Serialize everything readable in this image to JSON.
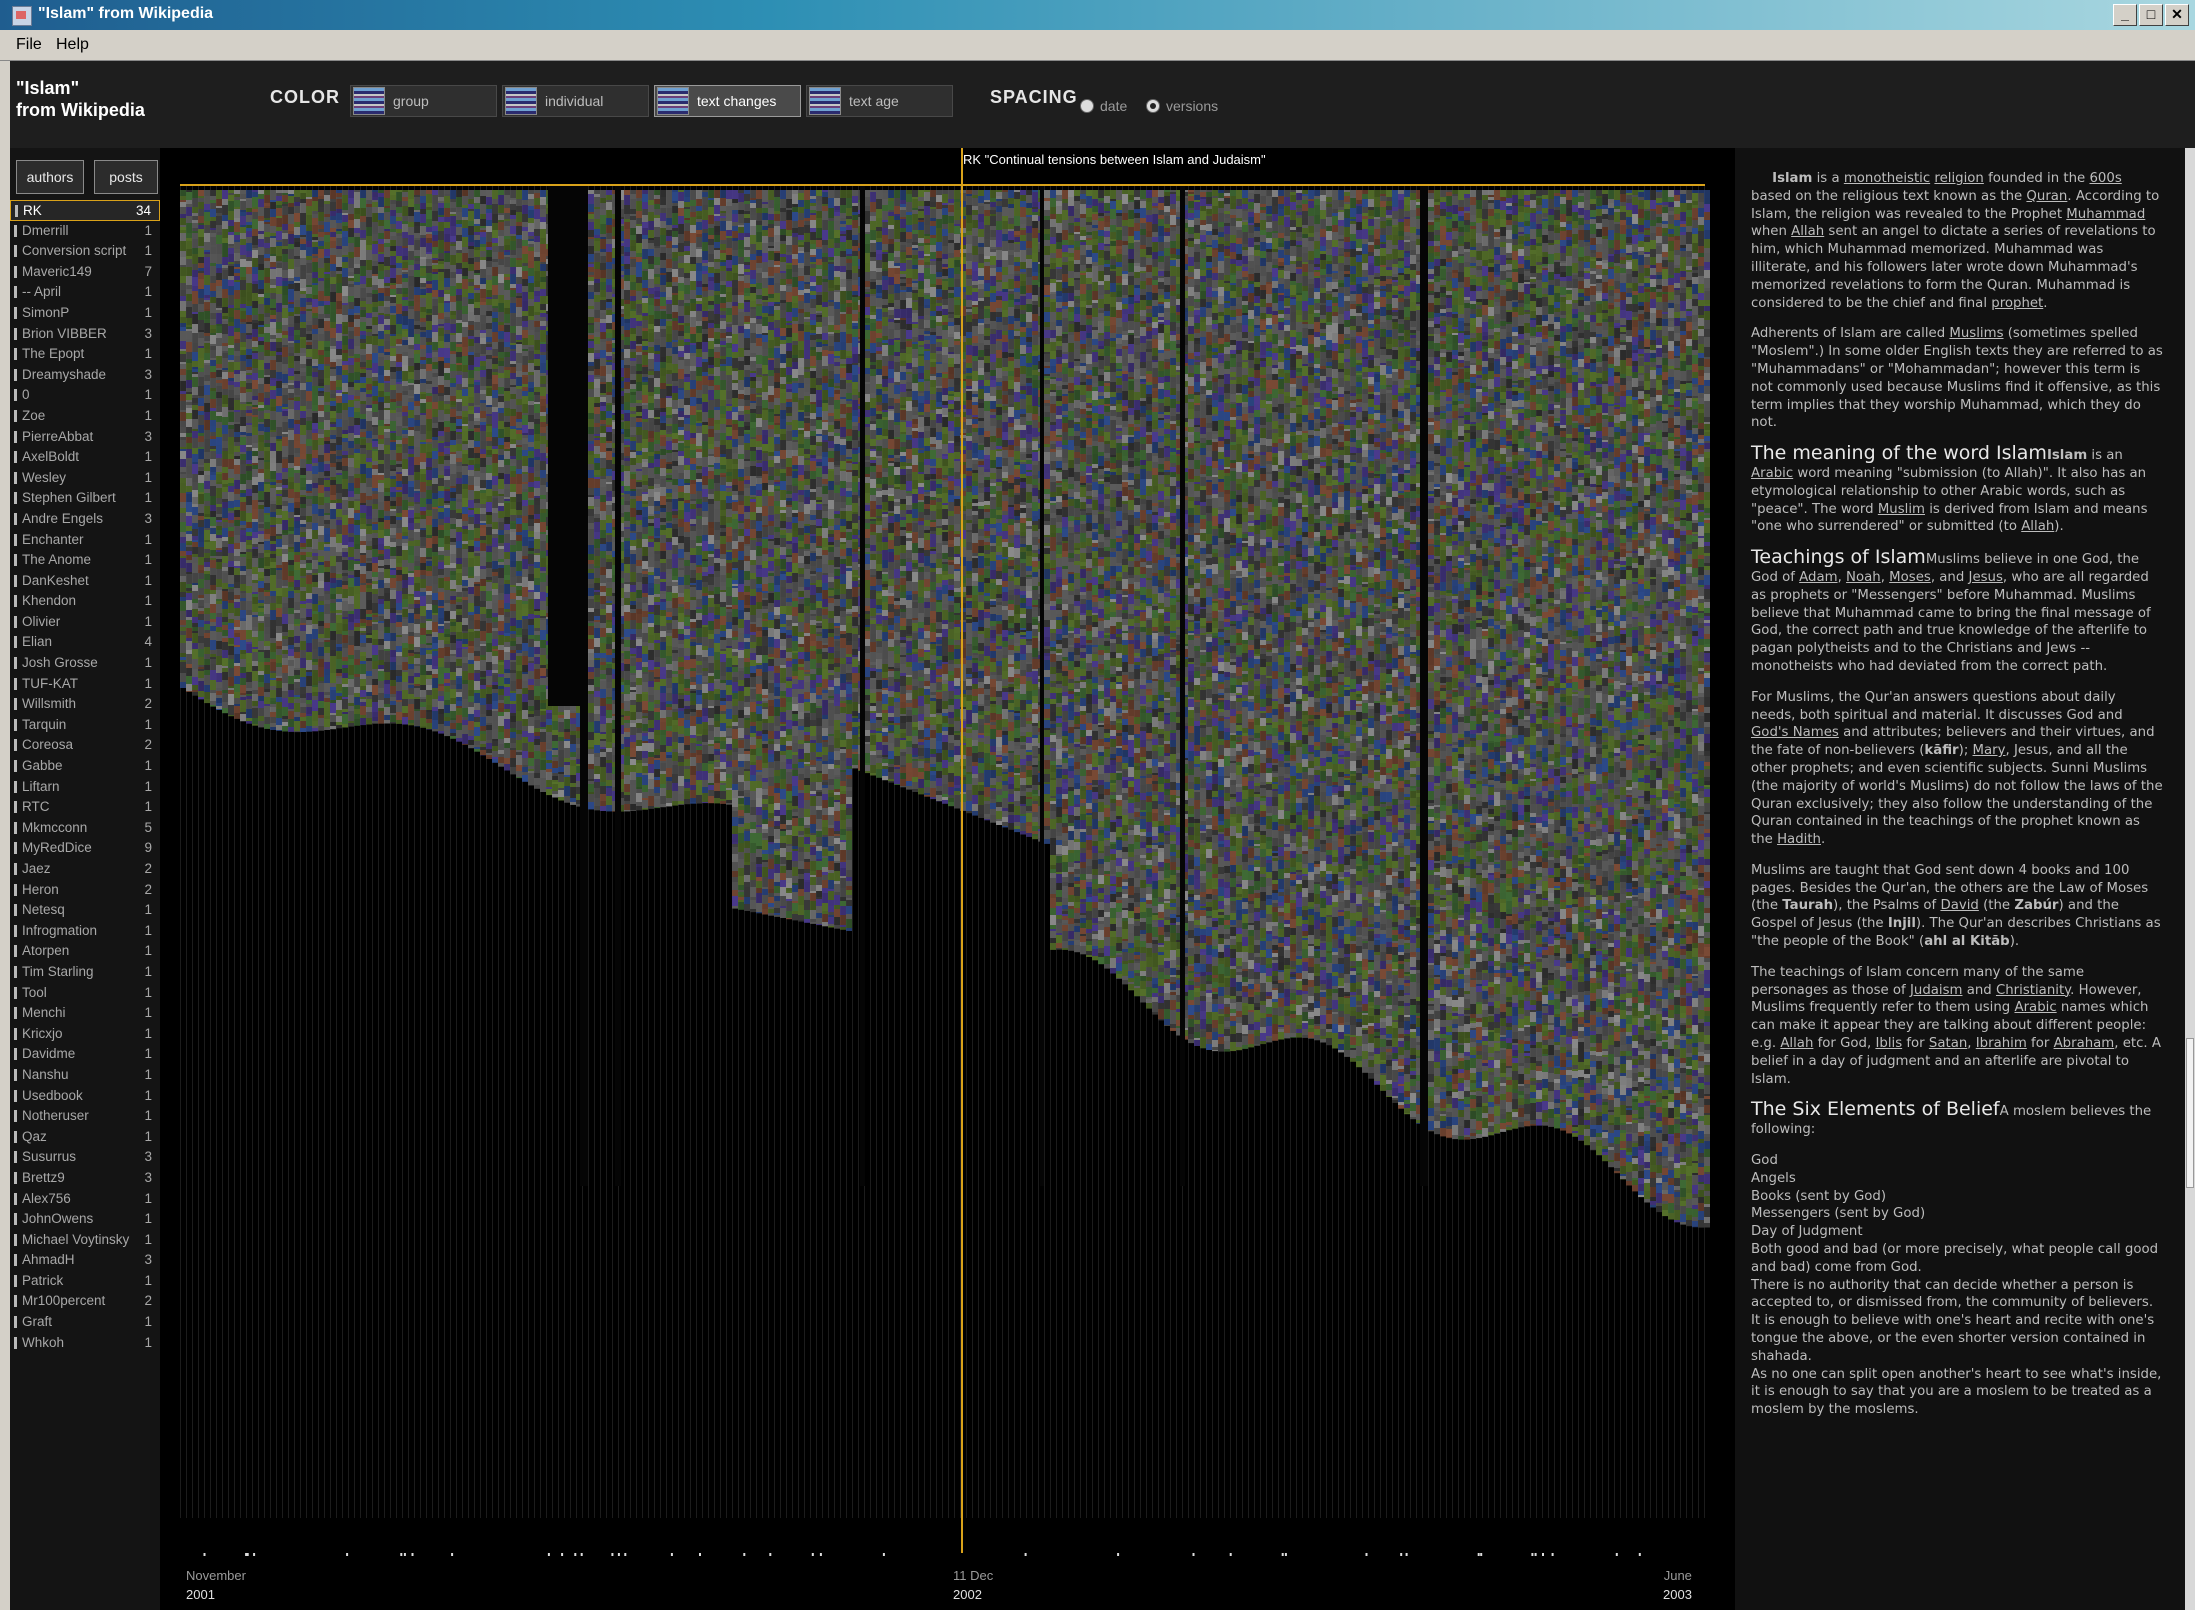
{
  "window": {
    "title": "\"Islam\" from Wikipedia",
    "minimize": "_",
    "maximize": "□",
    "close": "✕"
  },
  "menu": [
    {
      "label": "File"
    },
    {
      "label": "Help"
    }
  ],
  "app": {
    "title_line1": "\"Islam\"",
    "title_line2": "from Wikipedia"
  },
  "toolbar": {
    "color_label": "COLOR",
    "color_modes": [
      {
        "label": "group",
        "active": false
      },
      {
        "label": "individual",
        "active": false
      },
      {
        "label": "text changes",
        "active": true
      },
      {
        "label": "text age",
        "active": false
      }
    ],
    "spacing_label": "SPACING",
    "spacing_options": [
      {
        "label": "date",
        "selected": false
      },
      {
        "label": "versions",
        "selected": true
      }
    ]
  },
  "sidebar": {
    "tabs": [
      {
        "label": "authors"
      },
      {
        "label": "posts"
      }
    ],
    "authors": [
      {
        "name": "RK",
        "count": "34",
        "selected": true
      },
      {
        "name": "Dmerrill",
        "count": "1"
      },
      {
        "name": "Conversion script",
        "count": "1"
      },
      {
        "name": "Maveric149",
        "count": "7"
      },
      {
        "name": "-- April",
        "count": "1"
      },
      {
        "name": "SimonP",
        "count": "1"
      },
      {
        "name": "Brion VIBBER",
        "count": "3"
      },
      {
        "name": "The Epopt",
        "count": "1"
      },
      {
        "name": "Dreamyshade",
        "count": "3"
      },
      {
        "name": "0",
        "count": "1"
      },
      {
        "name": "Zoe",
        "count": "1"
      },
      {
        "name": "PierreAbbat",
        "count": "3"
      },
      {
        "name": "AxelBoldt",
        "count": "1"
      },
      {
        "name": "Wesley",
        "count": "1"
      },
      {
        "name": "Stephen Gilbert",
        "count": "1"
      },
      {
        "name": "Andre Engels",
        "count": "3"
      },
      {
        "name": "Enchanter",
        "count": "1"
      },
      {
        "name": "The Anome",
        "count": "1"
      },
      {
        "name": "DanKeshet",
        "count": "1"
      },
      {
        "name": "Khendon",
        "count": "1"
      },
      {
        "name": "Olivier",
        "count": "1"
      },
      {
        "name": "Elian",
        "count": "4"
      },
      {
        "name": "Josh Grosse",
        "count": "1"
      },
      {
        "name": "TUF-KAT",
        "count": "1"
      },
      {
        "name": "Willsmith",
        "count": "2"
      },
      {
        "name": "Tarquin",
        "count": "1"
      },
      {
        "name": "Coreosa",
        "count": "2"
      },
      {
        "name": "Gabbe",
        "count": "1"
      },
      {
        "name": "Liftarn",
        "count": "1"
      },
      {
        "name": "RTC",
        "count": "1"
      },
      {
        "name": "Mkmcconn",
        "count": "5"
      },
      {
        "name": "MyRedDice",
        "count": "9"
      },
      {
        "name": "Jaez",
        "count": "2"
      },
      {
        "name": "Heron",
        "count": "2"
      },
      {
        "name": "Netesq",
        "count": "1"
      },
      {
        "name": "Infrogmation",
        "count": "1"
      },
      {
        "name": "Atorpen",
        "count": "1"
      },
      {
        "name": "Tim Starling",
        "count": "1"
      },
      {
        "name": "Tool",
        "count": "1"
      },
      {
        "name": "Menchi",
        "count": "1"
      },
      {
        "name": "Kricxjo",
        "count": "1"
      },
      {
        "name": "Davidme",
        "count": "1"
      },
      {
        "name": "Nanshu",
        "count": "1"
      },
      {
        "name": "Usedbook",
        "count": "1"
      },
      {
        "name": "Notheruser",
        "count": "1"
      },
      {
        "name": "Qaz",
        "count": "1"
      },
      {
        "name": "Susurrus",
        "count": "3"
      },
      {
        "name": "Brettz9",
        "count": "3"
      },
      {
        "name": "Alex756",
        "count": "1"
      },
      {
        "name": "JohnOwens",
        "count": "1"
      },
      {
        "name": "Michael Voytinsky",
        "count": "1"
      },
      {
        "name": "AhmadH",
        "count": "3"
      },
      {
        "name": "Patrick",
        "count": "1"
      },
      {
        "name": "Mr100percent",
        "count": "2"
      },
      {
        "name": "Graft",
        "count": "1"
      },
      {
        "name": "Whkoh",
        "count": "1"
      }
    ]
  },
  "visualization": {
    "hover_label": "RK \"Continual tensions between Islam and Judaism\"",
    "dates": {
      "start": {
        "month": "November",
        "year": "2001"
      },
      "middle": {
        "month": "11 Dec",
        "year": "2002"
      },
      "end": {
        "month": "June",
        "year": "2003"
      }
    },
    "palette": {
      "gray": "#5c5c5c",
      "dark_gray": "#3a3a3a",
      "light_gray": "#8a8a8a",
      "olive": "#55702a",
      "green": "#3f6a35",
      "purple": "#4a3a8c",
      "blue": "#2d4a8a",
      "brown": "#7a4a35",
      "highlight": "#d9a21a"
    }
  },
  "article": {
    "p1": {
      "title": "Islam",
      "t1": " is a ",
      "l1": "monotheistic",
      "t2": " ",
      "l2": "religion",
      "t3": " founded in the ",
      "l3": "600s",
      "t4": " based on the religious text known as the ",
      "l4": "Quran",
      "t5": ". According to Islam, the religion was revealed to the Prophet ",
      "l5": "Muhammad",
      "t6": " when ",
      "l6": "Allah",
      "t7": " sent an angel to dictate a series of revelations to him, which Muhammad memorized.  Muhammad was illiterate, and his followers later wrote down Muhammad's memorized revelations to form the Quran. Muhammad is considered to be the chief and final ",
      "l7": "prophet",
      "t8": "."
    },
    "p2": {
      "t1": "Adherents of Islam are called ",
      "l1": "Muslims",
      "t2": " (sometimes spelled \"Moslem\".)  In some older English texts they are referred to as \"Muhammadans\" or \"Mohammadan\"; however this term is not commonly used because Muslims find it offensive, as this term implies that they worship Muhammad, which they do not."
    },
    "h1": "The meaning of the word Islam",
    "p3": {
      "lead": "Islam",
      "t1": " is an ",
      "l1": "Arabic",
      "t2": " word meaning \"submission (to Allah)\". It also has an etymological relationship to other Arabic words, such as \"peace\". The word ",
      "l2": "Muslim",
      "t3": " is derived from Islam and means \"one who surrendered\" or submitted (to ",
      "l3": "Allah",
      "t4": ")."
    },
    "h2": "Teachings of Islam",
    "p4": {
      "lead": "Muslims believe in one God, the God of ",
      "l1": "Adam",
      "t1": ", ",
      "l2": "Noah",
      "t2": ", ",
      "l3": "Moses",
      "t3": ", and ",
      "l4": "Jesus",
      "t4": ", who are all regarded as prophets or \"Messengers\" before Muhammad. Muslims believe that Muhammad came to bring the final message of God, the correct path and true knowledge of the afterlife to pagan polytheists and to the Christians and Jews -- monotheists who had deviated from the correct path."
    },
    "p5": {
      "t1": "For Muslims, the Qur'an answers questions about daily needs, both spiritual and material. It discusses God and ",
      "l1": "God's Names",
      "t2": " and attributes; believers and their virtues, and the fate of non-believers (",
      "b1": "kāfir",
      "t3": "); ",
      "l2": "Mary",
      "t4": ", Jesus, and all the other prophets; and even scientific subjects. Sunni Muslims (the majority of world's Muslims) do not follow the laws of the Quran exclusively; they also follow the understanding of the Quran contained in the teachings of the prophet known as the ",
      "l3": "Hadith",
      "t5": "."
    },
    "p6": {
      "t1": "Muslims are taught that God sent down 4 books and 100 pages. Besides the Qur'an, the others are the Law of Moses (the ",
      "b1": "Taurah",
      "t2": "), the Psalms of ",
      "l1": "David",
      "t3": " (the ",
      "b2": "Zabúr",
      "t4": ") and the Gospel of Jesus (the ",
      "b3": "Injil",
      "t5": "). The Qur'an describes Christians as \"the people of the Book\" (",
      "b4": "ahl al Kitāb",
      "t6": ")."
    },
    "p7": {
      "t1": "The teachings of Islam concern many of the same personages as those of ",
      "l1": "Judaism",
      "t2": " and ",
      "l2": "Christianity",
      "t3": ". However, Muslims frequently refer to them using ",
      "l3": "Arabic",
      "t4": " names which can make it appear they are talking about different people: e.g. ",
      "l4": "Allah",
      "t5": " for God, ",
      "l5": "Iblis",
      "t6": " for ",
      "l6": "Satan",
      "t7": ", ",
      "l7": "Ibrahim",
      "t8": " for ",
      "l8": "Abraham",
      "t9": ", etc.  A belief in a day of judgment and an afterlife are pivotal to Islam."
    },
    "h3": "The Six Elements of Belief",
    "p8": {
      "lead": "A moslem believes the following:"
    },
    "beliefs": [
      "God",
      "Angels",
      "Books (sent by God)",
      "Messengers (sent by God)",
      "Day of Judgment",
      "Both good and bad (or more precisely, what people call good and bad) come from God.",
      "There is no authority that can decide whether a person is accepted to, or dismissed from, the community of believers. It is enough to believe with one's heart and recite with one's tongue the above, or the even shorter version contained in shahada.",
      "As no one can split open another's heart to see what's inside, it is enough to say that you are a moslem to be treated as a moslem by the moslems."
    ]
  }
}
